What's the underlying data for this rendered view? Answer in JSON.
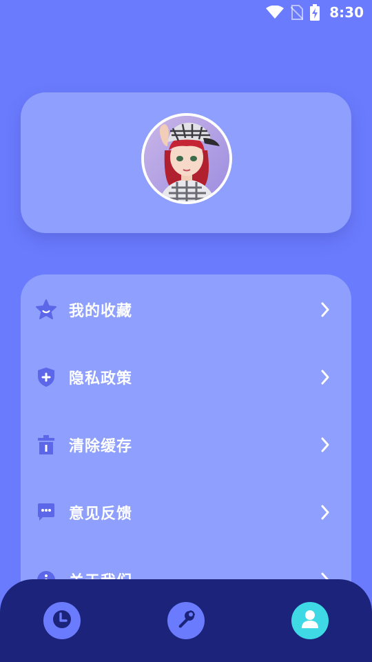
{
  "status_bar": {
    "time": "8:30",
    "icons": [
      "wifi-icon",
      "no-sim-icon",
      "battery-charging-icon"
    ]
  },
  "profile": {
    "avatar": "avatar"
  },
  "menu": {
    "items": [
      {
        "label": "我的收藏",
        "icon": "star-icon"
      },
      {
        "label": "隐私政策",
        "icon": "shield-icon"
      },
      {
        "label": "清除缓存",
        "icon": "trash-icon"
      },
      {
        "label": "意见反馈",
        "icon": "feedback-icon"
      },
      {
        "label": "关于我们",
        "icon": "info-icon"
      }
    ]
  },
  "bottom_nav": {
    "items": [
      {
        "icon": "clock-icon",
        "active": false
      },
      {
        "icon": "wrench-icon",
        "active": false
      },
      {
        "icon": "user-icon",
        "active": true
      }
    ]
  },
  "colors": {
    "background": "#6A7BFD",
    "card": "#8E9FFD",
    "icon": "#5B67E8",
    "nav_bar": "#1B247A",
    "nav_active": "#3FD9E5"
  }
}
